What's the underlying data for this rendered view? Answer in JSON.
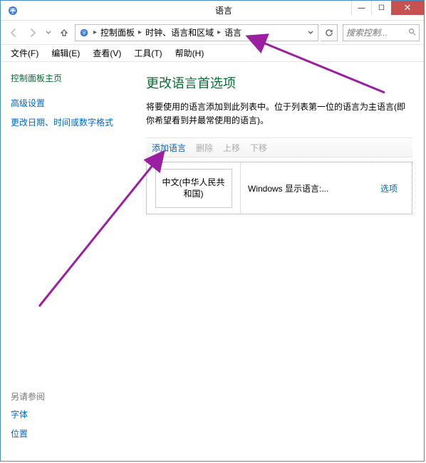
{
  "titlebar": {
    "title": "语言"
  },
  "navbar": {
    "breadcrumbs": [
      "控制面板",
      "时钟、语言和区域",
      "语言"
    ],
    "search_placeholder": "搜索控制..."
  },
  "menubar": {
    "file": "文件(F)",
    "edit": "编辑(E)",
    "view": "查看(V)",
    "tools": "工具(T)",
    "help": "帮助(H)"
  },
  "leftpane": {
    "cp_home": "控制面板主页",
    "link_advanced": "高级设置",
    "link_datefmt": "更改日期、时间或数字格式",
    "see_also_label": "另请参阅",
    "link_fonts": "字体",
    "link_location": "位置"
  },
  "rightpane": {
    "heading": "更改语言首选项",
    "desc": "将要使用的语言添加到此列表中。位于列表第一位的语言为主语言(即你希望看到并最常使用的语言)。",
    "toolbar": {
      "add": "添加语言",
      "remove": "删除",
      "moveup": "上移",
      "movedown": "下移"
    },
    "lang": {
      "name": "中文(中华人民共和国)",
      "detail": "Windows 显示语言:...",
      "options": "选项"
    }
  }
}
